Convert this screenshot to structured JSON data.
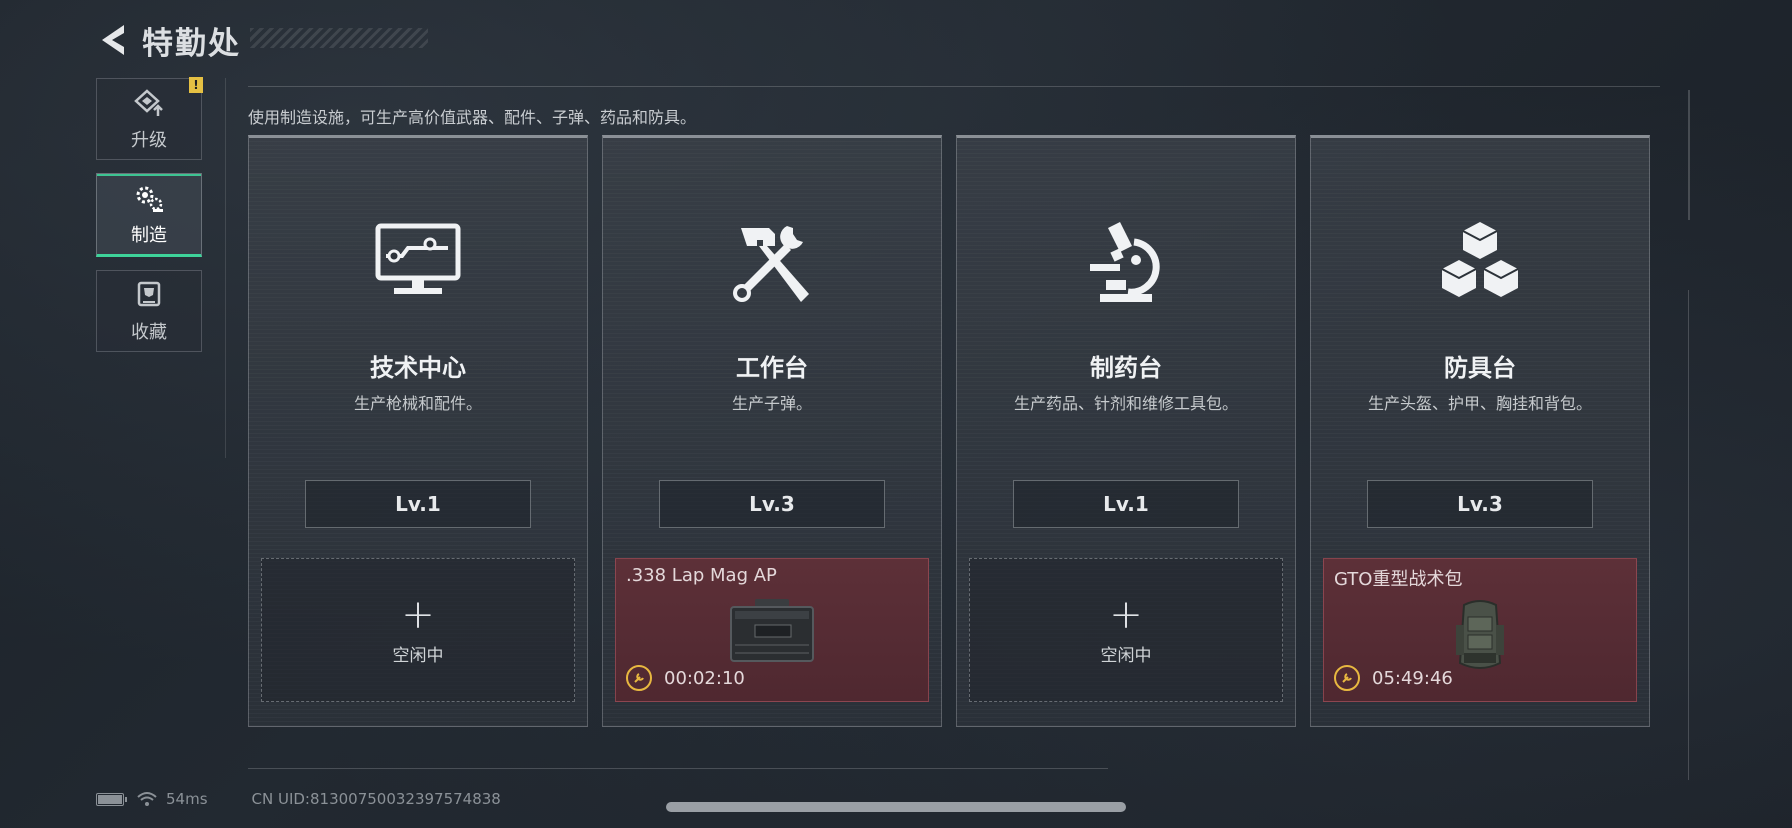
{
  "header": {
    "title": "特勤处"
  },
  "sidebar": {
    "items": [
      {
        "label": "升级",
        "icon": "upgrade-icon",
        "active": false,
        "warning": "!"
      },
      {
        "label": "制造",
        "icon": "gears-icon",
        "active": true
      },
      {
        "label": "收藏",
        "icon": "trophy-icon",
        "active": false
      }
    ]
  },
  "description": "使用制造设施，可生产高价值武器、配件、子弹、药品和防具。",
  "cards": [
    {
      "title": "技术中心",
      "desc": "生产枪械和配件。",
      "level": "Lv.1",
      "icon": "monitor-icon",
      "slot": {
        "state": "idle",
        "label": "空闲中"
      }
    },
    {
      "title": "工作台",
      "desc": "生产子弹。",
      "level": "Lv.3",
      "icon": "hammer-wrench-icon",
      "slot": {
        "state": "busy",
        "item": ".338 Lap Mag AP",
        "timer": "00:02:10"
      }
    },
    {
      "title": "制药台",
      "desc": "生产药品、针剂和维修工具包。",
      "level": "Lv.1",
      "icon": "microscope-icon",
      "slot": {
        "state": "idle",
        "label": "空闲中"
      }
    },
    {
      "title": "防具台",
      "desc": "生产头盔、护甲、胸挂和背包。",
      "level": "Lv.3",
      "icon": "cubes-icon",
      "slot": {
        "state": "busy",
        "item": "GTO重型战术包",
        "timer": "05:49:46"
      }
    }
  ],
  "status": {
    "ping": "54ms",
    "uid": "CN UID:81300750032397574838"
  },
  "colors": {
    "accent": "#3ed39a",
    "warning": "#e5c043",
    "busy_slot": "#5d3038"
  }
}
